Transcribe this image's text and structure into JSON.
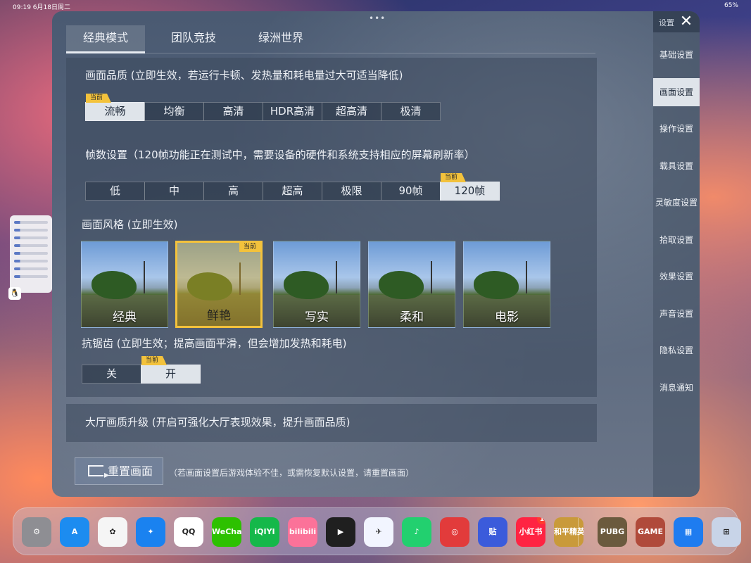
{
  "status_bar": {
    "time": "09:19  6月18日周二",
    "right": "65%"
  },
  "window": {
    "tabs": [
      {
        "label": "经典模式"
      },
      {
        "label": "团队竞技"
      },
      {
        "label": "绿洲世界"
      }
    ],
    "current_tag": "当前",
    "quality": {
      "title": "画面品质 (立即生效，若运行卡顿、发热量和耗电量过大可适当降低)",
      "options": [
        "流畅",
        "均衡",
        "高清",
        "HDR高清",
        "超高清",
        "极清"
      ],
      "selected": "流畅"
    },
    "framerate": {
      "title": "帧数设置（120帧功能正在测试中，需要设备的硬件和系统支持相应的屏幕刷新率）",
      "options": [
        "低",
        "中",
        "高",
        "超高",
        "极限",
        "90帧",
        "120帧"
      ],
      "selected": "120帧"
    },
    "style": {
      "title": "画面风格 (立即生效)",
      "options": [
        "经典",
        "鲜艳",
        "写实",
        "柔和",
        "电影"
      ],
      "selected": "鲜艳"
    },
    "antialias": {
      "title": "抗锯齿 (立即生效；提高画面平滑，但会增加发热和耗电)",
      "options": [
        "关",
        "开"
      ],
      "selected": "开"
    },
    "lobby_upgrade": {
      "title": "大厅画质升级 (开启可强化大厅表现效果，提升画面品质)"
    },
    "reset": {
      "button_label": "重置画面",
      "note": "（若画面设置后游戏体验不佳，或需恢复默认设置，请重置画面）"
    }
  },
  "sidebar": {
    "header": "设置",
    "items": [
      "基础设置",
      "画面设置",
      "操作设置",
      "载具设置",
      "灵敏度设置",
      "拾取设置",
      "效果设置",
      "声音设置",
      "隐私设置",
      "消息通知"
    ],
    "active": "画面设置"
  },
  "dock": {
    "apps": [
      {
        "name": "settings",
        "label": "⚙",
        "color": "#8e8e93"
      },
      {
        "name": "app-store",
        "label": "A",
        "color": "#1c8cf0"
      },
      {
        "name": "photos",
        "label": "✿",
        "color": "#f5f5f5"
      },
      {
        "name": "safari",
        "label": "✦",
        "color": "#1a82f0"
      },
      {
        "name": "qq",
        "label": "QQ",
        "color": "#ffffff"
      },
      {
        "name": "wechat",
        "label": "WeChat",
        "color": "#2dc100"
      },
      {
        "name": "iqiyi",
        "label": "iQIYI",
        "color": "#15b84a"
      },
      {
        "name": "bilibili",
        "label": "bilibili",
        "color": "#fb7299"
      },
      {
        "name": "tencent-video",
        "label": "▶",
        "color": "#1f1f1f"
      },
      {
        "name": "feishu",
        "label": "✈",
        "color": "#f2f5ff"
      },
      {
        "name": "qq-music",
        "label": "♪",
        "color": "#22d06f"
      },
      {
        "name": "netease-music",
        "label": "◎",
        "color": "#e23b3b"
      },
      {
        "name": "tieba",
        "label": "贴",
        "color": "#3b5bdb"
      },
      {
        "name": "xiaohongshu",
        "label": "小红书",
        "color": "#ff2442",
        "badge": "1"
      },
      {
        "name": "honor-of-kings",
        "label": "和平精英",
        "color": "#c99a3a"
      },
      {
        "name": "pubg",
        "label": "PUBG",
        "color": "#6b5a3e"
      },
      {
        "name": "game-2",
        "label": "GAME",
        "color": "#b04a3a"
      },
      {
        "name": "widget-app",
        "label": "▦",
        "color": "#1e7cf0"
      },
      {
        "name": "app-library",
        "label": "⊞",
        "color": "#c8d4e8"
      }
    ]
  }
}
